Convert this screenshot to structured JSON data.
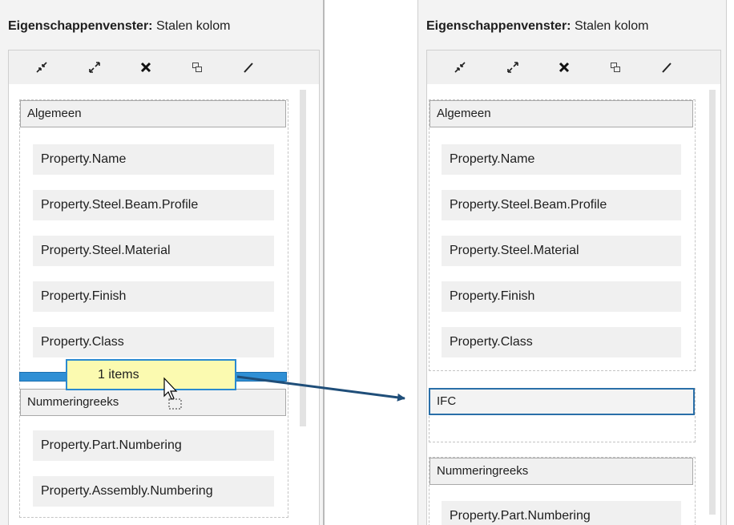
{
  "panel_title_bold": "Eigenschappenvenster:",
  "panel_title_object": "Stalen kolom",
  "toolbar_icons": [
    "collapse-icon",
    "expand-icon",
    "delete-icon",
    "copy-icon",
    "edit-icon"
  ],
  "before": {
    "groups": [
      {
        "header": "Algemeen",
        "items": [
          "Property.Name",
          "Property.Steel.Beam.Profile",
          "Property.Steel.Material",
          "Property.Finish",
          "Property.Class"
        ]
      },
      {
        "header": "Nummeringreeks",
        "items": [
          "Property.Part.Numbering",
          "Property.Assembly.Numbering"
        ]
      }
    ],
    "drag_label": "1 items"
  },
  "after": {
    "groups": [
      {
        "header": "Algemeen",
        "items": [
          "Property.Name",
          "Property.Steel.Beam.Profile",
          "Property.Steel.Material",
          "Property.Finish",
          "Property.Class"
        ]
      },
      {
        "header": "IFC",
        "items": []
      },
      {
        "header": "Nummeringreeks",
        "items": [
          "Property.Part.Numbering"
        ]
      }
    ]
  },
  "colors": {
    "accent": "#2a8ad0",
    "tooltip": "#fbfab0",
    "arrow": "#1f4e79"
  }
}
